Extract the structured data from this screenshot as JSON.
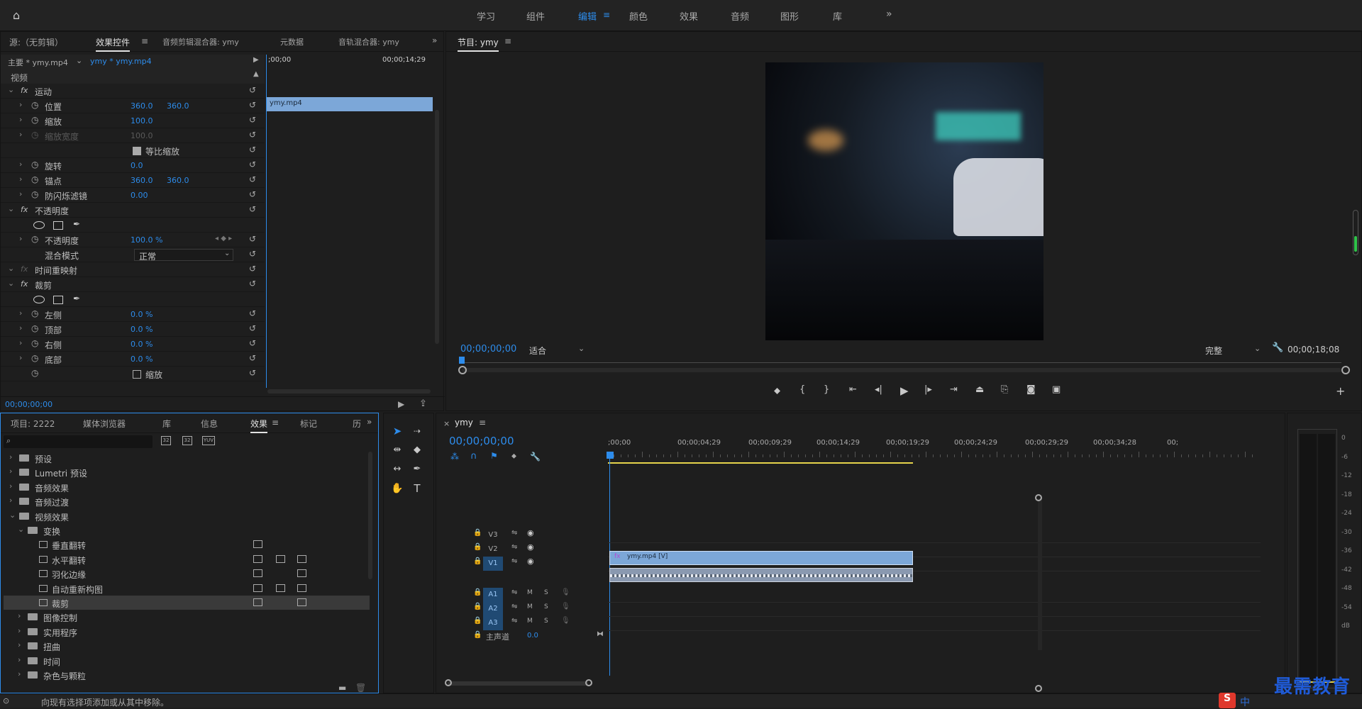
{
  "workspaces": {
    "items": [
      "学习",
      "组件",
      "编辑",
      "颜色",
      "效果",
      "音频",
      "图形",
      "库"
    ],
    "active_index": 2,
    "more": "»"
  },
  "effect_panel": {
    "tabs": [
      "源:（无剪辑）",
      "效果控件",
      "音频剪辑混合器: ymy",
      "元数据",
      "音轨混合器: ymy"
    ],
    "active_tab": 1,
    "master": "主要 * ymy.mp4",
    "clip": "ymy * ymy.mp4",
    "section_video": "视频",
    "timecode_start": ";00;00",
    "timecode_end": "00;00;14;29",
    "clip_bar": "ymy.mp4",
    "footer_time": "00;00;00;00",
    "rows": [
      {
        "type": "group",
        "name": "运动",
        "fx": "fx"
      },
      {
        "type": "prop",
        "name": "位置",
        "v1": "360.0",
        "v2": "360.0"
      },
      {
        "type": "prop",
        "name": "缩放",
        "v1": "100.0"
      },
      {
        "type": "prop",
        "name": "缩放宽度",
        "v1": "100.0",
        "disabled": true
      },
      {
        "type": "check",
        "name": "等比缩放"
      },
      {
        "type": "prop",
        "name": "旋转",
        "v1": "0.0"
      },
      {
        "type": "prop",
        "name": "锚点",
        "v1": "360.0",
        "v2": "360.0"
      },
      {
        "type": "prop",
        "name": "防闪烁滤镜",
        "v1": "0.00"
      },
      {
        "type": "group",
        "name": "不透明度",
        "fx": "fx"
      },
      {
        "type": "shapes"
      },
      {
        "type": "prop",
        "name": "不透明度",
        "v1": "100.0 %"
      },
      {
        "type": "select",
        "name": "混合模式",
        "value": "正常"
      },
      {
        "type": "group",
        "name": "时间重映射",
        "fx": "fx",
        "dimfx": true
      },
      {
        "type": "group",
        "name": "裁剪",
        "fx": "fx"
      },
      {
        "type": "shapes"
      },
      {
        "type": "prop",
        "name": "左侧",
        "v1": "0.0 %"
      },
      {
        "type": "prop",
        "name": "顶部",
        "v1": "0.0 %"
      },
      {
        "type": "prop",
        "name": "右侧",
        "v1": "0.0 %"
      },
      {
        "type": "prop",
        "name": "底部",
        "v1": "0.0 %"
      },
      {
        "type": "check",
        "name": "缩放"
      }
    ]
  },
  "program": {
    "title": "节目: ymy",
    "timecode": "00;00;00;00",
    "fit": "适合",
    "quality": "完整",
    "duration": "00;00;18;08"
  },
  "project_panel": {
    "tabs": [
      "项目: 2222",
      "媒体浏览器",
      "库",
      "信息",
      "效果",
      "标记",
      "历"
    ],
    "active_tab": 4,
    "search_placeholder": "",
    "icons": [
      "32",
      "32",
      "YUV"
    ],
    "items": [
      {
        "name": "预设",
        "level": 0,
        "kind": "folder-star",
        "open": false
      },
      {
        "name": "Lumetri 预设",
        "level": 0,
        "kind": "folder-star",
        "open": false
      },
      {
        "name": "音频效果",
        "level": 0,
        "kind": "folder",
        "open": false
      },
      {
        "name": "音频过渡",
        "level": 0,
        "kind": "folder",
        "open": false
      },
      {
        "name": "视频效果",
        "level": 0,
        "kind": "folder",
        "open": true
      },
      {
        "name": "变换",
        "level": 1,
        "kind": "folder",
        "open": true
      },
      {
        "name": "垂直翻转",
        "level": 2,
        "kind": "effect",
        "badges": [
          1,
          0,
          0
        ]
      },
      {
        "name": "水平翻转",
        "level": 2,
        "kind": "effect",
        "badges": [
          1,
          1,
          1
        ]
      },
      {
        "name": "羽化边缘",
        "level": 2,
        "kind": "effect",
        "badges": [
          1,
          0,
          1
        ]
      },
      {
        "name": "自动重新构图",
        "level": 2,
        "kind": "effect",
        "badges": [
          1,
          1,
          1
        ]
      },
      {
        "name": "裁剪",
        "level": 2,
        "kind": "effect",
        "badges": [
          1,
          0,
          1
        ],
        "selected": true
      },
      {
        "name": "图像控制",
        "level": 1,
        "kind": "folder",
        "open": false
      },
      {
        "name": "实用程序",
        "level": 1,
        "kind": "folder",
        "open": false
      },
      {
        "name": "扭曲",
        "level": 1,
        "kind": "folder",
        "open": false
      },
      {
        "name": "时间",
        "level": 1,
        "kind": "folder",
        "open": false
      },
      {
        "name": "杂色与颗粒",
        "level": 1,
        "kind": "folder",
        "open": false
      }
    ]
  },
  "timeline": {
    "tab": "ymy",
    "timecode": "00;00;00;00",
    "ruler": [
      ";00;00",
      "00;00;04;29",
      "00;00;09;29",
      "00;00;14;29",
      "00;00;19;29",
      "00;00;24;29",
      "00;00;29;29",
      "00;00;34;28",
      "00;"
    ],
    "video_tracks": [
      "V3",
      "V2",
      "V1"
    ],
    "audio_tracks": [
      "A1",
      "A2",
      "A3"
    ],
    "mute": "M",
    "solo": "S",
    "master_label": "主声道",
    "master_value": "0.0",
    "video_clip": "ymy.mp4 [V]",
    "clip_fx": "fx"
  },
  "meter": {
    "labels": [
      "0",
      "-6",
      "-12",
      "-18",
      "-24",
      "-30",
      "-36",
      "-42",
      "-48",
      "-54",
      "dB"
    ]
  },
  "status": {
    "text": "向现有选择项添加或从其中移除。"
  },
  "watermark": {
    "text": "最需教育",
    "ime": "中"
  },
  "colors": {
    "accent": "#2d8ceb",
    "clip_video": "#7ca7d8",
    "clip_audio": "#8a99b0",
    "workarea": "#e6d44b"
  }
}
